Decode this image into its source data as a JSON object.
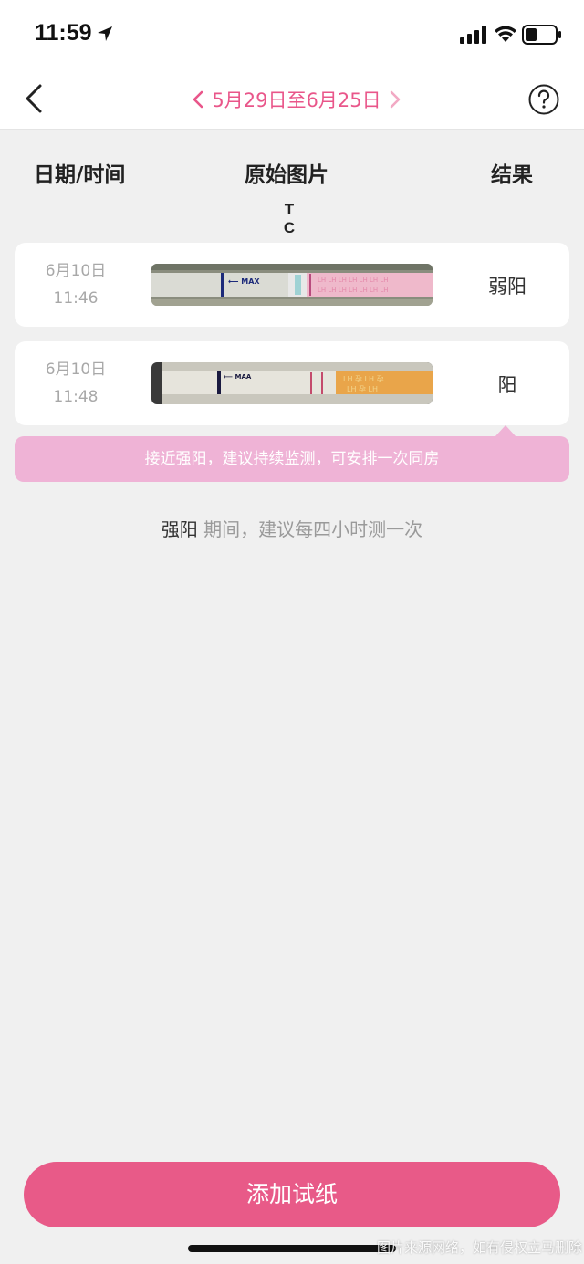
{
  "status_bar": {
    "time": "11:59"
  },
  "nav": {
    "date_range": "5月29日至6月25日"
  },
  "table": {
    "headers": {
      "date_time": "日期/时间",
      "image": "原始图片",
      "result": "结果"
    },
    "tc_label": "T C"
  },
  "records": [
    {
      "date": "6月10日",
      "time": "11:46",
      "result": "弱阳"
    },
    {
      "date": "6月10日",
      "time": "11:48",
      "result": "阳"
    }
  ],
  "advice": "接近强阳，建议持续监测，可安排一次同房",
  "tip": {
    "strong": "强阳",
    "rest": " 期间，建议每四小时测一次"
  },
  "add_button_label": "添加试纸",
  "watermark": "图片来源网络，如有侵权立马删除",
  "colors": {
    "accent": "#e85a88",
    "advice_bg": "#efb3d6",
    "range_text": "#e9568a"
  },
  "icons": [
    "location-arrow-icon",
    "signal-icon",
    "wifi-icon",
    "battery-icon",
    "back-chevron-icon",
    "chevron-left-icon",
    "chevron-right-icon",
    "help-icon"
  ]
}
